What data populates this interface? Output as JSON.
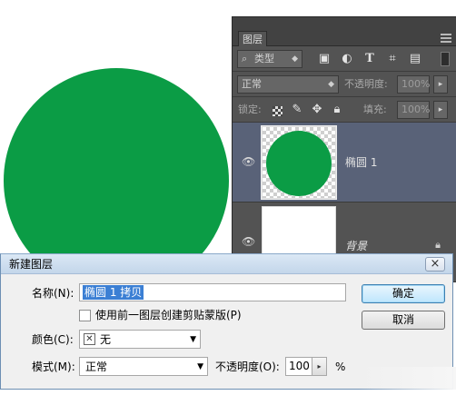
{
  "colors": {
    "circle_fill": "#0b9c45",
    "panel_bg": "#535353",
    "selected_layer_bg": "#596278",
    "dialog_bg": "#f0f0f0",
    "selection_highlight": "#3b7fd4"
  },
  "layers_panel": {
    "tab_label": "图层",
    "filter": {
      "kind_label": "类型",
      "icons": [
        "pixel-filter-icon",
        "adjustment-filter-icon",
        "type-filter-icon",
        "shape-filter-icon",
        "smart-object-filter-icon"
      ]
    },
    "blend_mode": "正常",
    "opacity_label": "不透明度:",
    "opacity_value": "100%",
    "lock_label": "锁定:",
    "fill_label": "填充:",
    "fill_value": "100%",
    "layers": [
      {
        "name": "椭圆 1",
        "selected": true,
        "visible": true
      },
      {
        "name": "背景",
        "selected": false,
        "visible": true,
        "locked": true
      }
    ]
  },
  "dialog": {
    "title": "新建图层",
    "name_label": "名称(N):",
    "name_value": "椭圆 1 拷贝",
    "clip_checkbox_label": "使用前一图层创建剪贴蒙版(P)",
    "clip_checked": false,
    "color_label": "颜色(C):",
    "color_value": "无",
    "mode_label": "模式(M):",
    "mode_value": "正常",
    "opacity_label": "不透明度(O):",
    "opacity_value": "100",
    "percent": "%",
    "ok_label": "确定",
    "cancel_label": "取消",
    "close_glyph": "×"
  }
}
